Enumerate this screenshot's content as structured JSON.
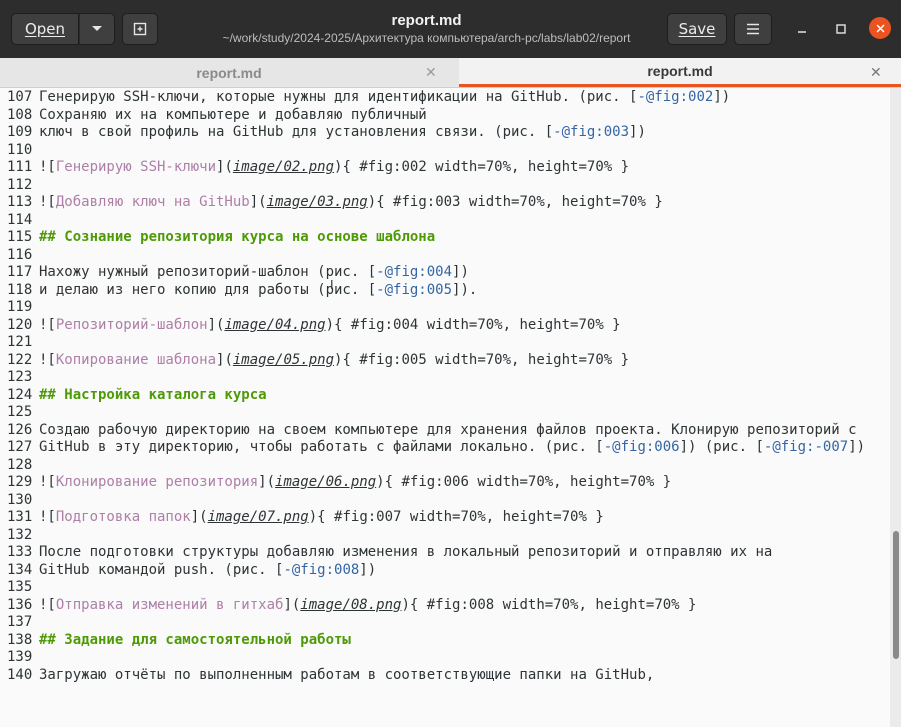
{
  "header": {
    "open_label": "Open",
    "save_label": "Save",
    "title": "report.md",
    "subtitle": "~/work/study/2024-2025/Архитектура компьютера/arch-pc/labs/lab02/report"
  },
  "tabs": [
    {
      "label": "report.md",
      "active": false
    },
    {
      "label": "report.md",
      "active": true
    }
  ],
  "icons": {
    "dropdown": "chevron-down-icon",
    "new_tab": "new-tab-icon",
    "menu": "hamburger-menu-icon",
    "minimize": "minimize-icon",
    "maximize": "maximize-icon",
    "close": "close-icon"
  },
  "colors": {
    "accent": "#e95420",
    "heading": "#4e9a06",
    "link_text": "#ad7fa8",
    "reference": "#3465a4"
  },
  "editor": {
    "lines": [
      {
        "n": "107",
        "segs": [
          [
            "t",
            "Генерирую SSH-ключи, которые нужны для идентификации на GitHub. (рис. ["
          ],
          [
            "r",
            "-@fig:002"
          ],
          [
            "t",
            "])"
          ]
        ]
      },
      {
        "n": "108",
        "segs": [
          [
            "t",
            "Сохраняю их на компьютере и добавляю публичный"
          ]
        ]
      },
      {
        "n": "109",
        "segs": [
          [
            "t",
            "ключ в свой профиль на GitHub для установления связи. (рис. ["
          ],
          [
            "r",
            "-@fig:003"
          ],
          [
            "t",
            "])"
          ]
        ]
      },
      {
        "n": "110",
        "segs": []
      },
      {
        "n": "111",
        "segs": [
          [
            "t",
            "!["
          ],
          [
            "a",
            "Генерирую SSH-ключи"
          ],
          [
            "t",
            "]("
          ],
          [
            "p",
            "image/02.png"
          ],
          [
            "t",
            ")"
          ],
          [
            "t",
            "{ #fig:002 width=70%, height=70% }"
          ]
        ]
      },
      {
        "n": "112",
        "segs": []
      },
      {
        "n": "113",
        "segs": [
          [
            "t",
            "!["
          ],
          [
            "a",
            "Добавляю ключ на GitHub"
          ],
          [
            "t",
            "]("
          ],
          [
            "p",
            "image/03.png"
          ],
          [
            "t",
            ")"
          ],
          [
            "t",
            "{ #fig:003 width=70%, height=70% }"
          ]
        ]
      },
      {
        "n": "114",
        "segs": []
      },
      {
        "n": "115",
        "segs": [
          [
            "h",
            "## Сознание репозитория курса на основе шаблона"
          ]
        ]
      },
      {
        "n": "116",
        "segs": []
      },
      {
        "n": "117",
        "segs": [
          [
            "t",
            "Нахожу нужный репозиторий-шаблон (рис. ["
          ],
          [
            "r",
            "-@fig:004"
          ],
          [
            "t",
            "])"
          ]
        ]
      },
      {
        "n": "118",
        "segs": [
          [
            "t",
            "и делаю из него копию для работы (рис. ["
          ],
          [
            "r",
            "-@fig:005"
          ],
          [
            "t",
            "])."
          ]
        ]
      },
      {
        "n": "119",
        "segs": []
      },
      {
        "n": "120",
        "segs": [
          [
            "t",
            "!["
          ],
          [
            "a",
            "Репозиторий-шаблон"
          ],
          [
            "t",
            "]("
          ],
          [
            "p",
            "image/04.png"
          ],
          [
            "t",
            ")"
          ],
          [
            "t",
            "{ #fig:004 width=70%, height=70% }"
          ]
        ]
      },
      {
        "n": "121",
        "segs": []
      },
      {
        "n": "122",
        "segs": [
          [
            "t",
            "!["
          ],
          [
            "a",
            "Копирование шаблона"
          ],
          [
            "t",
            "]("
          ],
          [
            "p",
            "image/05.png"
          ],
          [
            "t",
            ")"
          ],
          [
            "t",
            "{ #fig:005 width=70%, height=70% }"
          ]
        ]
      },
      {
        "n": "123",
        "segs": []
      },
      {
        "n": "124",
        "segs": [
          [
            "h",
            "## Настройка каталога курса"
          ]
        ]
      },
      {
        "n": "125",
        "segs": []
      },
      {
        "n": "126",
        "segs": [
          [
            "t",
            "Создаю рабочую директорию на своем компьютере для хранения файлов проекта. Клонирую репозиторий с"
          ]
        ]
      },
      {
        "n": "127",
        "segs": [
          [
            "t",
            "GitHub в эту директорию, чтобы работать с файлами локально. (рис. ["
          ],
          [
            "r",
            "-@fig:006"
          ],
          [
            "t",
            "]) (рис. ["
          ],
          [
            "r",
            "-@fig:-007"
          ],
          [
            "t",
            "])"
          ]
        ]
      },
      {
        "n": "128",
        "segs": []
      },
      {
        "n": "129",
        "segs": [
          [
            "t",
            "!["
          ],
          [
            "a",
            "Клонирование репозитория"
          ],
          [
            "t",
            "]("
          ],
          [
            "p",
            "image/06.png"
          ],
          [
            "t",
            ")"
          ],
          [
            "t",
            "{ #fig:006 width=70%, height=70% }"
          ]
        ]
      },
      {
        "n": "130",
        "segs": []
      },
      {
        "n": "131",
        "segs": [
          [
            "t",
            "!["
          ],
          [
            "a",
            "Подготовка папок"
          ],
          [
            "t",
            "]("
          ],
          [
            "p",
            "image/07.png"
          ],
          [
            "t",
            ")"
          ],
          [
            "t",
            "{ #fig:007 width=70%, height=70% }"
          ]
        ]
      },
      {
        "n": "132",
        "segs": []
      },
      {
        "n": "133",
        "segs": [
          [
            "t",
            "После подготовки структуры добавляю изменения в локальный репозиторий и отправляю их на"
          ]
        ]
      },
      {
        "n": "134",
        "segs": [
          [
            "t",
            "GitHub командой push. (рис. ["
          ],
          [
            "r",
            "-@fig:008"
          ],
          [
            "t",
            "])"
          ]
        ]
      },
      {
        "n": "135",
        "segs": []
      },
      {
        "n": "136",
        "segs": [
          [
            "t",
            "!["
          ],
          [
            "a",
            "Отправка изменений в гитхаб"
          ],
          [
            "t",
            "]("
          ],
          [
            "p",
            "image/08.png"
          ],
          [
            "t",
            ")"
          ],
          [
            "t",
            "{ #fig:008 width=70%, height=70% }"
          ]
        ]
      },
      {
        "n": "137",
        "segs": []
      },
      {
        "n": "138",
        "segs": [
          [
            "h",
            "## Задание для самостоятельной работы"
          ]
        ]
      },
      {
        "n": "139",
        "segs": []
      },
      {
        "n": "140",
        "segs": [
          [
            "t",
            "Загружаю отчёты по выполненным работам в соответствующие папки на GitHub,"
          ]
        ]
      }
    ]
  }
}
